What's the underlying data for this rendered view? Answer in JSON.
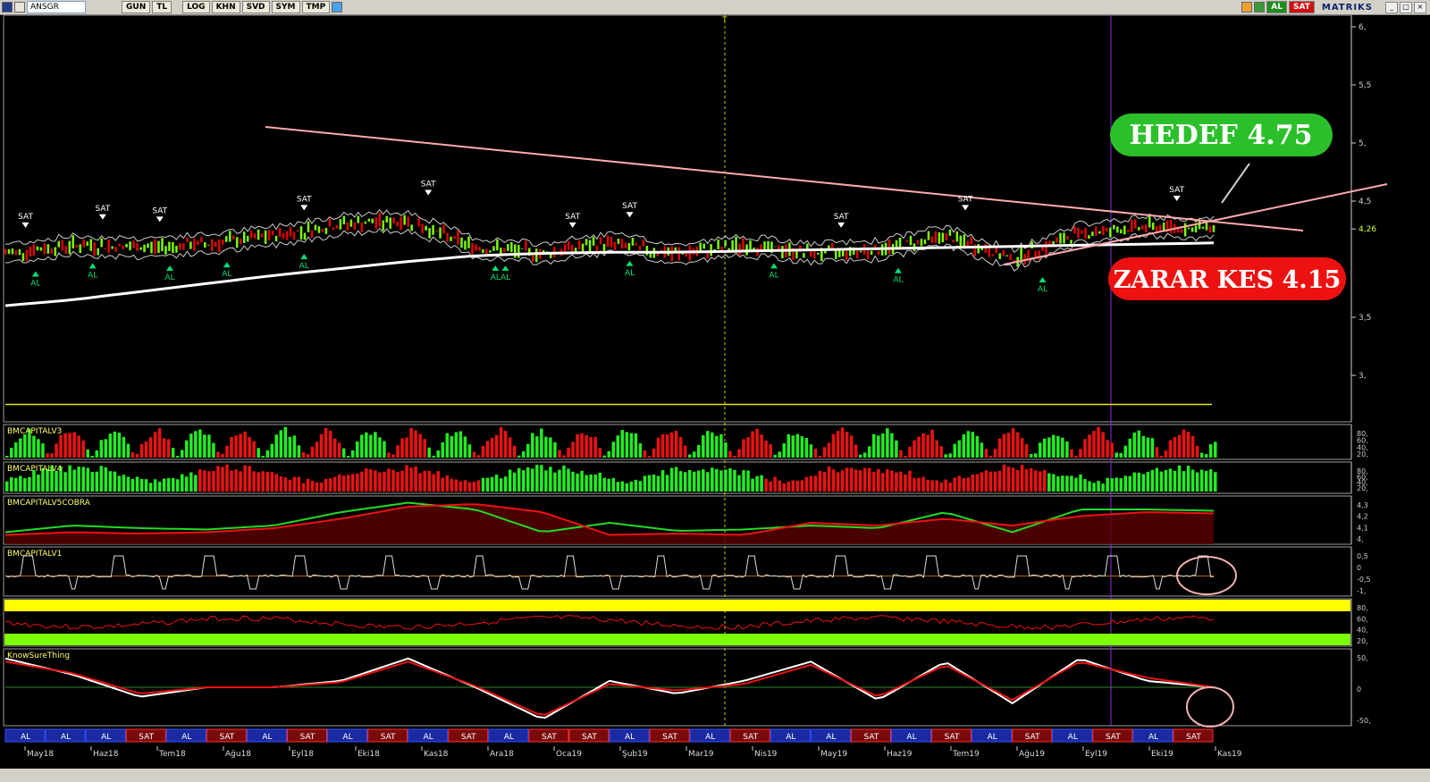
{
  "toolbar": {
    "symbol": "ANSGR",
    "period": "GUN",
    "currency": "TL",
    "buttons": [
      "LOG",
      "KHN",
      "SVD",
      "SYM",
      "TMP"
    ],
    "al_label": "AL",
    "sat_label": "SAT",
    "brand": "MATRIKS"
  },
  "colors": {
    "background": "#000000",
    "up": "#7cfc00",
    "down": "#e00000",
    "hedef_bg": "#2bc02b",
    "zarar_bg": "#ee1111",
    "trend": "#ffaaaa",
    "ma": "#ffffff",
    "signal_buy": "#00e070",
    "signal_sell": "#ffffff",
    "signal_pink": "#ff66ff",
    "support_line": "#e6e600",
    "band_yellow": "#ffff00",
    "band_green": "#7cff00"
  },
  "annotations": {
    "target": "HEDEF 4.75",
    "stop": "ZARAR KES 4.15",
    "marker_label": "T",
    "last_price": "4,26",
    "al": "AL",
    "sat": "SAT"
  },
  "chart_data": [
    {
      "type": "line",
      "title": "ANSGR",
      "x": [
        "May18",
        "Haz18",
        "Tem18",
        "Ağu18",
        "Eyl18",
        "Eki18",
        "Kas18",
        "Ara18",
        "Oca19",
        "Şub19",
        "Mar19",
        "Nis19",
        "May19",
        "Haz19",
        "Tem19",
        "Ağu19",
        "Eyl19",
        "Eki19",
        "Kas19"
      ],
      "series": [
        {
          "values": [
            4.05,
            4.12,
            4.1,
            4.13,
            4.2,
            4.3,
            4.33,
            4.1,
            4.05,
            4.14,
            4.04,
            4.12,
            4.05,
            4.08,
            4.2,
            4.0,
            4.22,
            4.28,
            4.26
          ]
        },
        {
          "values": [
            3.6,
            3.65,
            3.72,
            3.79,
            3.86,
            3.92,
            3.98,
            4.03,
            4.05,
            4.06,
            4.06,
            4.07,
            4.08,
            4.09,
            4.1,
            4.11,
            4.12,
            4.13,
            4.14
          ]
        }
      ],
      "ylim": [
        2.6,
        6.1
      ],
      "yticks": [
        "6,",
        "5,5",
        "5,",
        "4,5",
        "4,26",
        "3,5",
        "3,"
      ],
      "target": 4.75,
      "stop": 4.15,
      "signals": {
        "sat": [
          "May18",
          "Haz18",
          "Tem18",
          "Eyl18",
          "Kas18",
          "Oca19",
          "Şub19",
          "May19",
          "Tem19",
          "Eki19"
        ],
        "al": [
          "May18",
          "Haz18",
          "Tem18",
          "Ağu18",
          "Eyl18",
          "Ara18",
          "Ara18",
          "Şub19",
          "Nis19",
          "Haz19",
          "Ağu19"
        ]
      }
    },
    {
      "type": "bar",
      "title": "BMCAPITALV3",
      "yticks": [
        "80,",
        "60,",
        "40,",
        "20,"
      ]
    },
    {
      "type": "bar",
      "title": "BMCAPITALV4",
      "yticks": [
        "80,",
        "60,",
        "40,",
        "20,"
      ]
    },
    {
      "type": "line",
      "title": "BMCAPITALV5COBRA",
      "yticks": [
        "4,3",
        "4,2",
        "4,1",
        "4,"
      ],
      "x": [
        "May18",
        "Haz18",
        "Tem18",
        "Ağu18",
        "Eyl18",
        "Eki18",
        "Kas18",
        "Ara18",
        "Oca19",
        "Şub19",
        "Mar19",
        "Nis19",
        "May19",
        "Haz19",
        "Tem19",
        "Ağu19",
        "Eyl19",
        "Eki19",
        "Kas19"
      ],
      "series": [
        {
          "values": [
            4.05,
            4.1,
            4.08,
            4.07,
            4.1,
            4.2,
            4.27,
            4.22,
            4.05,
            4.12,
            4.06,
            4.07,
            4.1,
            4.08,
            4.2,
            4.05,
            4.22,
            4.22,
            4.21
          ]
        },
        {
          "values": [
            4.03,
            4.05,
            4.04,
            4.05,
            4.08,
            4.15,
            4.24,
            4.26,
            4.2,
            4.03,
            4.04,
            4.03,
            4.12,
            4.1,
            4.15,
            4.1,
            4.17,
            4.2,
            4.19
          ]
        }
      ]
    },
    {
      "type": "line",
      "title": "BMCAPITALV1",
      "yticks": [
        "0,5",
        "0",
        "-0,5",
        "-1,"
      ]
    },
    {
      "type": "line",
      "title": "",
      "yticks": [
        "80,",
        "60,",
        "40,",
        "20,"
      ]
    },
    {
      "type": "line",
      "title": "KnowSureThing",
      "yticks": [
        "50,",
        "0",
        "-50,"
      ],
      "x": [
        "May18",
        "Haz18",
        "Tem18",
        "Ağu18",
        "Eyl18",
        "Eki18",
        "Kas18",
        "Ara18",
        "Oca19",
        "Şub19",
        "Mar19",
        "Nis19",
        "May19",
        "Haz19",
        "Tem19",
        "Ağu19",
        "Eyl19",
        "Eki19",
        "Kas19"
      ],
      "series": [
        {
          "values": [
            45,
            20,
            -15,
            0,
            0,
            10,
            45,
            0,
            -50,
            10,
            -10,
            10,
            40,
            -20,
            40,
            -25,
            45,
            10,
            0
          ]
        },
        {
          "values": [
            40,
            22,
            -10,
            0,
            0,
            8,
            40,
            2,
            -45,
            5,
            -5,
            5,
            35,
            -15,
            35,
            -20,
            40,
            15,
            0
          ]
        }
      ]
    }
  ],
  "signal_strip": [
    "AL",
    "AL",
    "AL",
    "SAT",
    "AL",
    "SAT",
    "AL",
    "SAT",
    "AL",
    "SAT",
    "AL",
    "SAT",
    "AL",
    "SAT",
    "SAT",
    "AL",
    "SAT",
    "AL",
    "SAT",
    "AL",
    "AL",
    "SAT",
    "AL",
    "SAT",
    "AL",
    "SAT",
    "AL",
    "SAT",
    "AL",
    "SAT"
  ],
  "date_axis": [
    "May18",
    "Haz18",
    "Tem18",
    "Ağu18",
    "Eyl18",
    "Eki18",
    "Kas18",
    "Ara18",
    "Oca19",
    "Şub19",
    "Mar19",
    "Nis19",
    "May19",
    "Haz19",
    "Tem19",
    "Ağu19",
    "Eyl19",
    "Eki19",
    "Kas19"
  ]
}
